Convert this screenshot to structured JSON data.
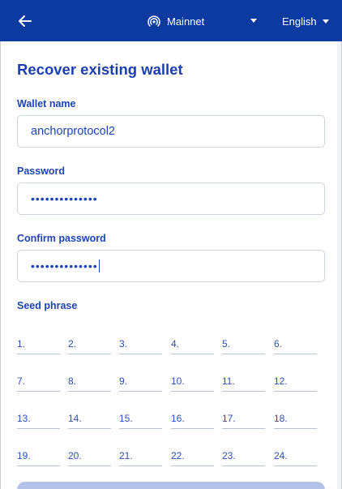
{
  "header": {
    "network_label": "Mainnet",
    "language_label": "English",
    "back_icon": "arrow-left-icon",
    "network_icon": "broadcast-icon"
  },
  "form": {
    "title": "Recover existing wallet",
    "wallet_name": {
      "label": "Wallet name",
      "value": "anchorprotocol2"
    },
    "password": {
      "label": "Password",
      "value": "••••••••••••••"
    },
    "confirm_password": {
      "label": "Confirm password",
      "value": "••••••••••••••"
    },
    "seed_phrase": {
      "label": "Seed phrase",
      "numbers": [
        "1.",
        "2.",
        "3.",
        "4.",
        "5.",
        "6.",
        "7.",
        "8.",
        "9.",
        "10.",
        "11.",
        "12.",
        "13.",
        "14.",
        "15.",
        "16.",
        "17.",
        "18.",
        "19.",
        "20.",
        "21.",
        "22.",
        "23.",
        "24."
      ]
    }
  },
  "colors": {
    "header_bg": "#0b3ba0",
    "accent": "#1d44b8",
    "input_border": "#cdd3e0",
    "button_disabled": "#b3c1e8"
  }
}
